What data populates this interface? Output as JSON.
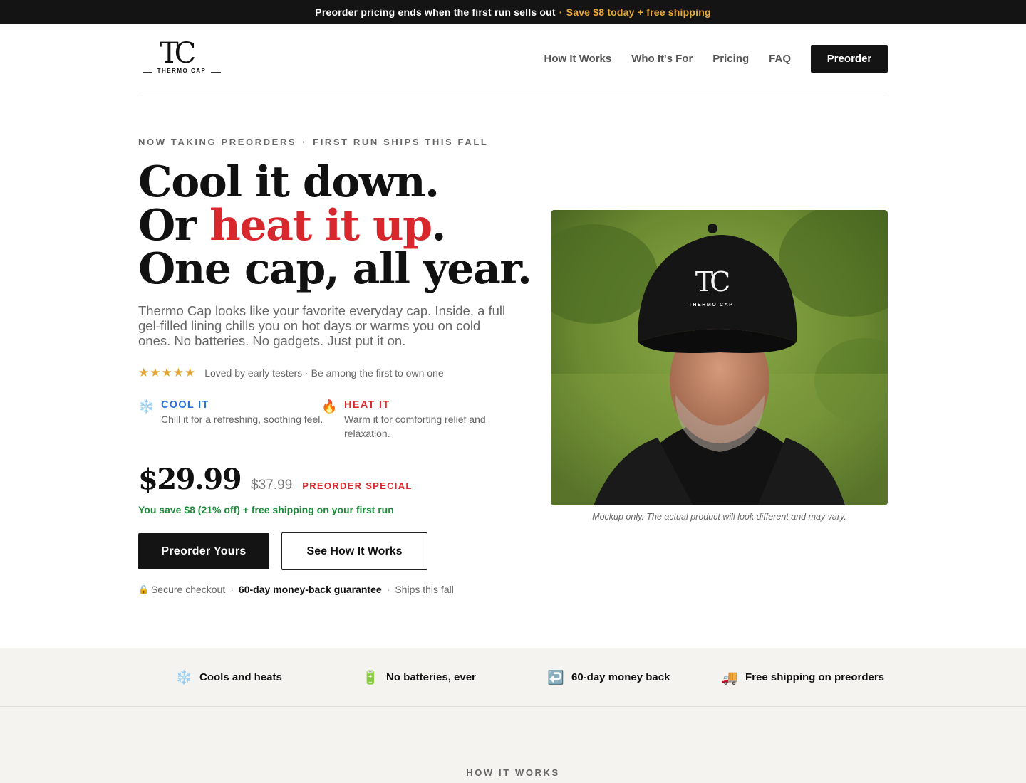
{
  "topbar": {
    "text": "Preorder pricing ends when the first run sells out",
    "separator": "·",
    "accent": "Save $8 today + free shipping"
  },
  "header": {
    "logo": {
      "monogram": "TC",
      "wordmark": "THERMO CAP"
    },
    "nav": [
      "How It Works",
      "Who It's For",
      "Pricing",
      "FAQ"
    ],
    "cta": "Preorder"
  },
  "hero": {
    "eyebrow_left": "NOW TAKING PREORDERS",
    "eyebrow_dot": "·",
    "eyebrow_right": "FIRST RUN SHIPS THIS FALL",
    "headline": {
      "line1": "Cool it down.",
      "line2_prefix": "Or ",
      "line2_red": "heat it up",
      "line2_suffix": ".",
      "line3": "One cap, all year."
    },
    "subtext": "Thermo Cap looks like your favorite everyday cap. Inside, a full gel-filled lining chills you on hot days or warms you on cold ones. No batteries. No gadgets. Just put it on.",
    "rating": {
      "stars": "★★★★★",
      "text": "Loved by early testers · Be among the first to own one"
    },
    "features": [
      {
        "icon": "snowflake-icon",
        "glyph": "❄️",
        "title": "COOL IT",
        "desc": "Chill it for a refreshing, soothing feel."
      },
      {
        "icon": "fire-icon",
        "glyph": "🔥",
        "title": "HEAT IT",
        "desc": "Warm it for comforting relief and relaxation."
      }
    ],
    "price": "$29.99",
    "old_price": "$37.99",
    "price_badge": "PREORDER SPECIAL",
    "savings": "You save $8 (21% off) + free shipping on your first run",
    "cta_primary": "Preorder Yours",
    "cta_secondary": "See How It Works",
    "trust": {
      "lock_glyph": "🔒",
      "secure": "Secure checkout",
      "dot": "·",
      "guarantee": "60-day money-back guarantee",
      "ships": "Ships this fall"
    },
    "image_logo": {
      "monogram": "TC",
      "wordmark": "THERMO CAP"
    },
    "image_caption": "Mockup only. The actual product will look different and may vary."
  },
  "strip": [
    {
      "icon": "snowflake-icon",
      "glyph": "❄️",
      "label": "Cools and heats"
    },
    {
      "icon": "battery-icon",
      "glyph": "🔋",
      "label": "No batteries, ever"
    },
    {
      "icon": "return-arrow-icon",
      "glyph": "↩️",
      "label": "60-day money back"
    },
    {
      "icon": "delivery-truck-icon",
      "glyph": "🚚",
      "label": "Free shipping on preorders"
    }
  ],
  "section": {
    "eyebrow": "HOW IT WORKS"
  },
  "colors": {
    "accent_red": "#d8282d",
    "accent_blue": "#2b6fd6",
    "accent_gold": "#e8a93a",
    "success_green": "#1f8a3c",
    "dark": "#141414"
  }
}
